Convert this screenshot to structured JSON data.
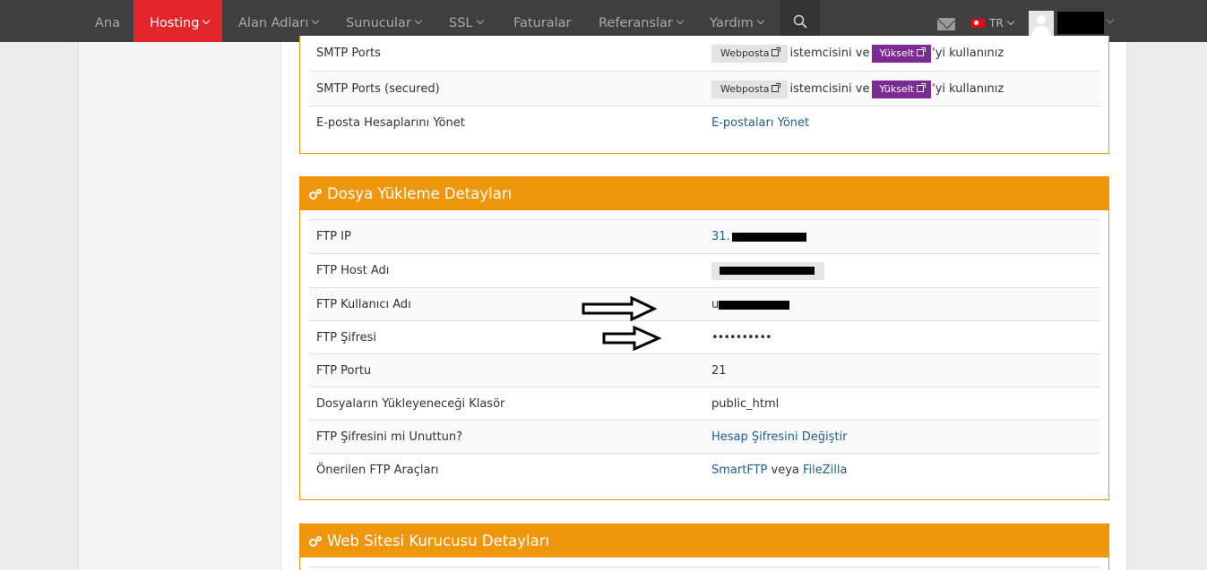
{
  "nav": {
    "items": [
      {
        "label": "Ana",
        "active": false,
        "dropdown": false
      },
      {
        "label": "Hosting",
        "active": true,
        "dropdown": true
      },
      {
        "label": "Alan Adları",
        "active": false,
        "dropdown": true
      },
      {
        "label": "Sunucular",
        "active": false,
        "dropdown": true
      },
      {
        "label": "SSL",
        "active": false,
        "dropdown": true
      },
      {
        "label": "Faturalar",
        "active": false,
        "dropdown": false
      },
      {
        "label": "Referanslar",
        "active": false,
        "dropdown": true
      },
      {
        "label": "Yardım",
        "active": false,
        "dropdown": true
      }
    ],
    "language": "TR",
    "icons": [
      "search-icon",
      "mail-icon",
      "flag-tr-icon",
      "avatar-icon"
    ]
  },
  "email_panel": {
    "rows": [
      {
        "label": "SMTP Ports",
        "webmail_btn": "Webposta",
        "text1": "istemcisini ve",
        "upgrade_btn": "Yükselt",
        "text2": "'yi kullanınız"
      },
      {
        "label": "SMTP Ports (secured)",
        "webmail_btn": "Webposta",
        "text1": "istemcisini ve",
        "upgrade_btn": "Yükselt",
        "text2": "'yi kullanınız"
      },
      {
        "label": "E-posta Hesaplarını Yönet",
        "link": "E-postaları Yönet"
      }
    ]
  },
  "ftp_panel": {
    "title": "Dosya Yükleme Detayları",
    "rows": {
      "ip": {
        "label": "FTP IP",
        "value_prefix": "31."
      },
      "host": {
        "label": "FTP Host Adı"
      },
      "user": {
        "label": "FTP Kullanıcı Adı",
        "value_prefix": "u"
      },
      "password": {
        "label": "FTP Şifresi",
        "value": "••••••••••"
      },
      "port": {
        "label": "FTP Portu",
        "value": "21"
      },
      "folder": {
        "label": "Dosyaların Yükleyeneceği Klasör",
        "value": "public_html"
      },
      "forgot": {
        "label": "FTP Şifresini mi Unuttun?",
        "link": "Hesap Şifresini Değiştir"
      },
      "tools": {
        "label": "Önerilen FTP Araçları",
        "link1": "SmartFTP",
        "sep": "veya",
        "link2": "FileZilla"
      }
    }
  },
  "builder_panel": {
    "title": "Web Sitesi Kurucusu Detayları"
  },
  "colors": {
    "nav_bg": "#3f3f3f",
    "nav_active": "#e3262a",
    "panel_accent": "#f0960b",
    "upgrade_btn": "#7b2a96",
    "link": "#1f5f8b"
  }
}
